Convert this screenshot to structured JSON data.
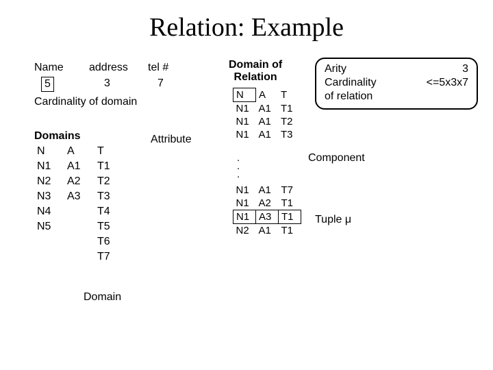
{
  "title": "Relation: Example",
  "header": {
    "name": "Name",
    "address": "address",
    "tel": "tel #",
    "name_val": "5",
    "address_val": "3",
    "tel_val": "7"
  },
  "card_label": "Cardinality of domain",
  "domains_header": "Domains",
  "attribute_label": "Attribute",
  "domain_label": "Domain",
  "domain_of_rel": "Domain of\nRelation",
  "component_label": "Component",
  "tuple_label": "Tuple μ",
  "box": {
    "arity_l": "Arity",
    "arity_v": "3",
    "card_l": "Cardinality",
    "card_v": "<=5x3x7",
    "ofrel": "of relation"
  },
  "domains_cols": {
    "c0": "N",
    "c1": "A",
    "c2": "T"
  },
  "domains_rows": [
    {
      "c0": "N1",
      "c1": "A1",
      "c2": "T1"
    },
    {
      "c0": "N2",
      "c1": "A2",
      "c2": "T2"
    },
    {
      "c0": "N3",
      "c1": "A3",
      "c2": "T3"
    },
    {
      "c0": "N4",
      "c1": "",
      "c2": "T4"
    },
    {
      "c0": "N5",
      "c1": "",
      "c2": "T5"
    },
    {
      "c0": "",
      "c1": "",
      "c2": "T6"
    },
    {
      "c0": "",
      "c1": "",
      "c2": "T7"
    }
  ],
  "rel_header": {
    "c0": "N",
    "c1": "A",
    "c2": "T"
  },
  "rel_rows_top": [
    {
      "c0": "N1",
      "c1": "A1",
      "c2": "T1"
    },
    {
      "c0": "N1",
      "c1": "A1",
      "c2": "T2"
    },
    {
      "c0": "N1",
      "c1": "A1",
      "c2": "T3"
    }
  ],
  "rel_rows_bot": [
    {
      "c0": "N1",
      "c1": "A1",
      "c2": "T7",
      "boxed": false
    },
    {
      "c0": "N1",
      "c1": "A2",
      "c2": "T1",
      "boxed": false
    },
    {
      "c0": "N1",
      "c1": "A3",
      "c2": "T1",
      "boxed": true
    },
    {
      "c0": "N2",
      "c1": "A1",
      "c2": "T1",
      "boxed": false
    }
  ]
}
